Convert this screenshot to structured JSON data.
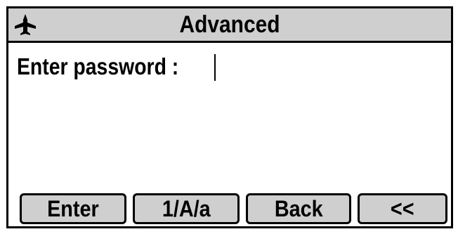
{
  "title_bar": {
    "icon": "airplane-icon",
    "title": "Advanced"
  },
  "prompt": {
    "label": "Enter password :",
    "value": ""
  },
  "softkeys": [
    {
      "label": "Enter"
    },
    {
      "label": "1/A/a"
    },
    {
      "label": "Back"
    },
    {
      "label": "<<"
    }
  ],
  "colors": {
    "bar_background": "#cfcfcf",
    "screen_background": "#ffffff",
    "border": "#000000"
  }
}
